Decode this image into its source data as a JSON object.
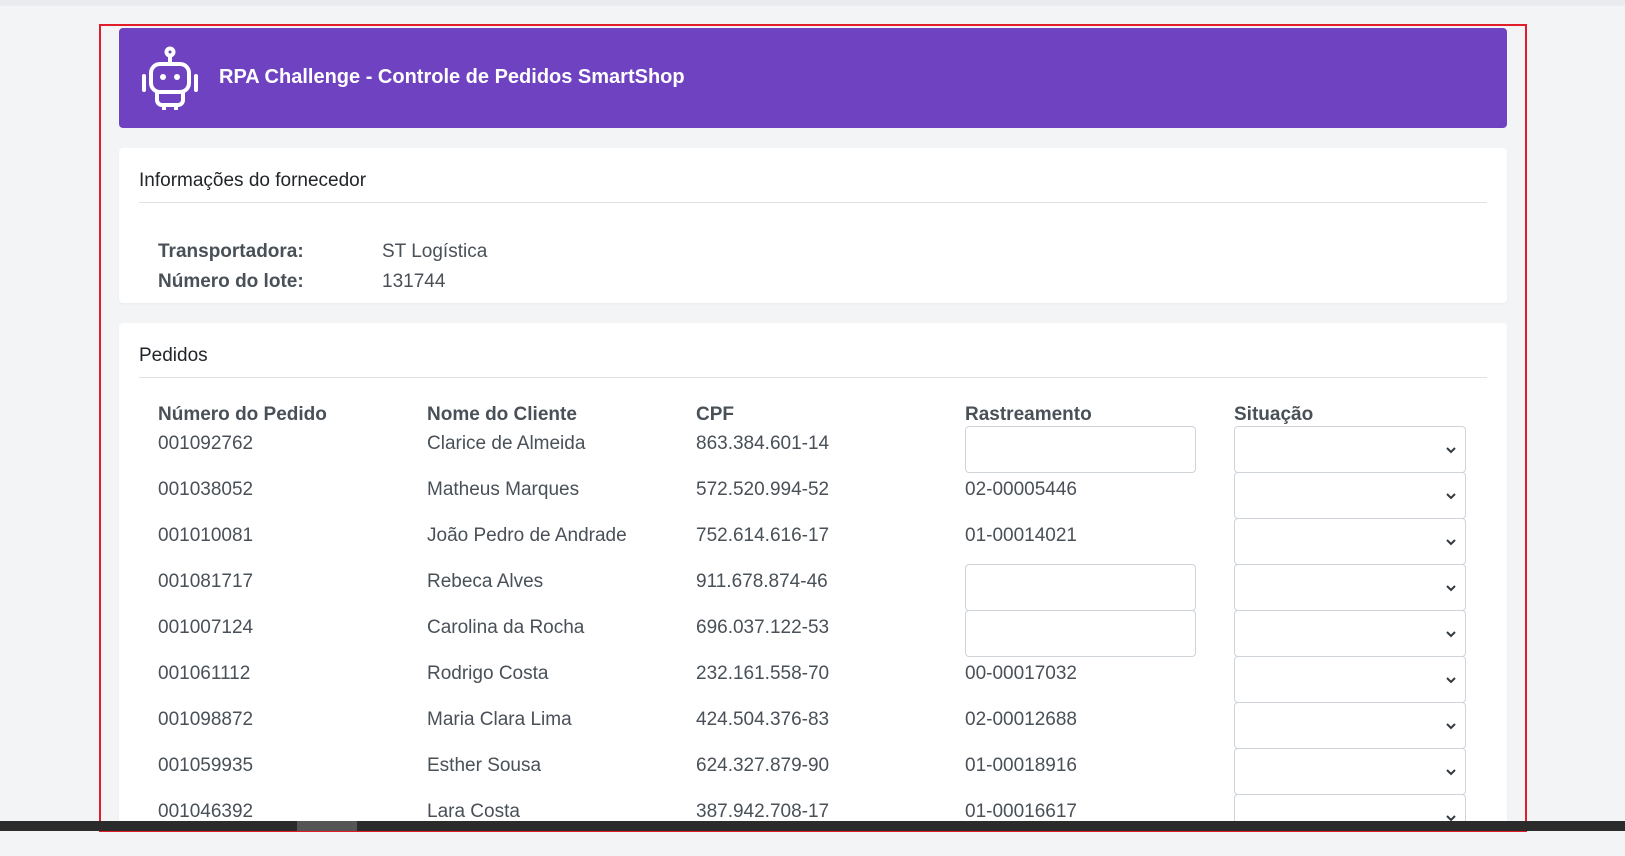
{
  "header": {
    "title": "RPA Challenge - Controle de Pedidos SmartShop"
  },
  "supplier": {
    "title": "Informações do fornecedor",
    "fields": [
      {
        "label": "Transportadora:",
        "value": "ST Logística"
      },
      {
        "label": "Número do lote:",
        "value": "131744"
      }
    ]
  },
  "orders": {
    "title": "Pedidos",
    "columns": [
      "Número do Pedido",
      "Nome do Cliente",
      "CPF",
      "Rastreamento",
      "Situação"
    ],
    "rows": [
      {
        "order": "001092762",
        "client": "Clarice de Almeida",
        "cpf": "863.384.601-14",
        "tracking": ""
      },
      {
        "order": "001038052",
        "client": "Matheus Marques",
        "cpf": "572.520.994-52",
        "tracking": "02-00005446"
      },
      {
        "order": "001010081",
        "client": "João Pedro de Andrade",
        "cpf": "752.614.616-17",
        "tracking": "01-00014021"
      },
      {
        "order": "001081717",
        "client": "Rebeca Alves",
        "cpf": "911.678.874-46",
        "tracking": ""
      },
      {
        "order": "001007124",
        "client": "Carolina da Rocha",
        "cpf": "696.037.122-53",
        "tracking": ""
      },
      {
        "order": "001061112",
        "client": "Rodrigo Costa",
        "cpf": "232.161.558-70",
        "tracking": "00-00017032"
      },
      {
        "order": "001098872",
        "client": "Maria Clara Lima",
        "cpf": "424.504.376-83",
        "tracking": "02-00012688"
      },
      {
        "order": "001059935",
        "client": "Esther Sousa",
        "cpf": "624.327.879-90",
        "tracking": "01-00018916"
      },
      {
        "order": "001046392",
        "client": "Lara Costa",
        "cpf": "387.942.708-17",
        "tracking": "01-00016617"
      }
    ],
    "status_selected": ""
  },
  "icons": {
    "logo": "robot-icon",
    "select": "chevron-down-icon"
  },
  "colors": {
    "header": "#6f42c1",
    "frame": "#e11d2a"
  }
}
